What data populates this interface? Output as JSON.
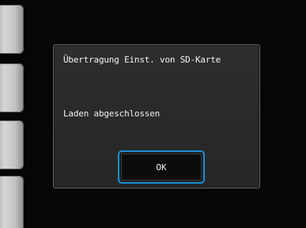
{
  "dialog": {
    "title": "Übertragung Einst. von SD-Karte",
    "message": "Laden abgeschlossen",
    "ok_label": "OK"
  },
  "colors": {
    "accent": "#1a8fd8",
    "dialog_background": "#2b2b2b",
    "screen_background": "#060606",
    "text": "#f2f2f2"
  }
}
